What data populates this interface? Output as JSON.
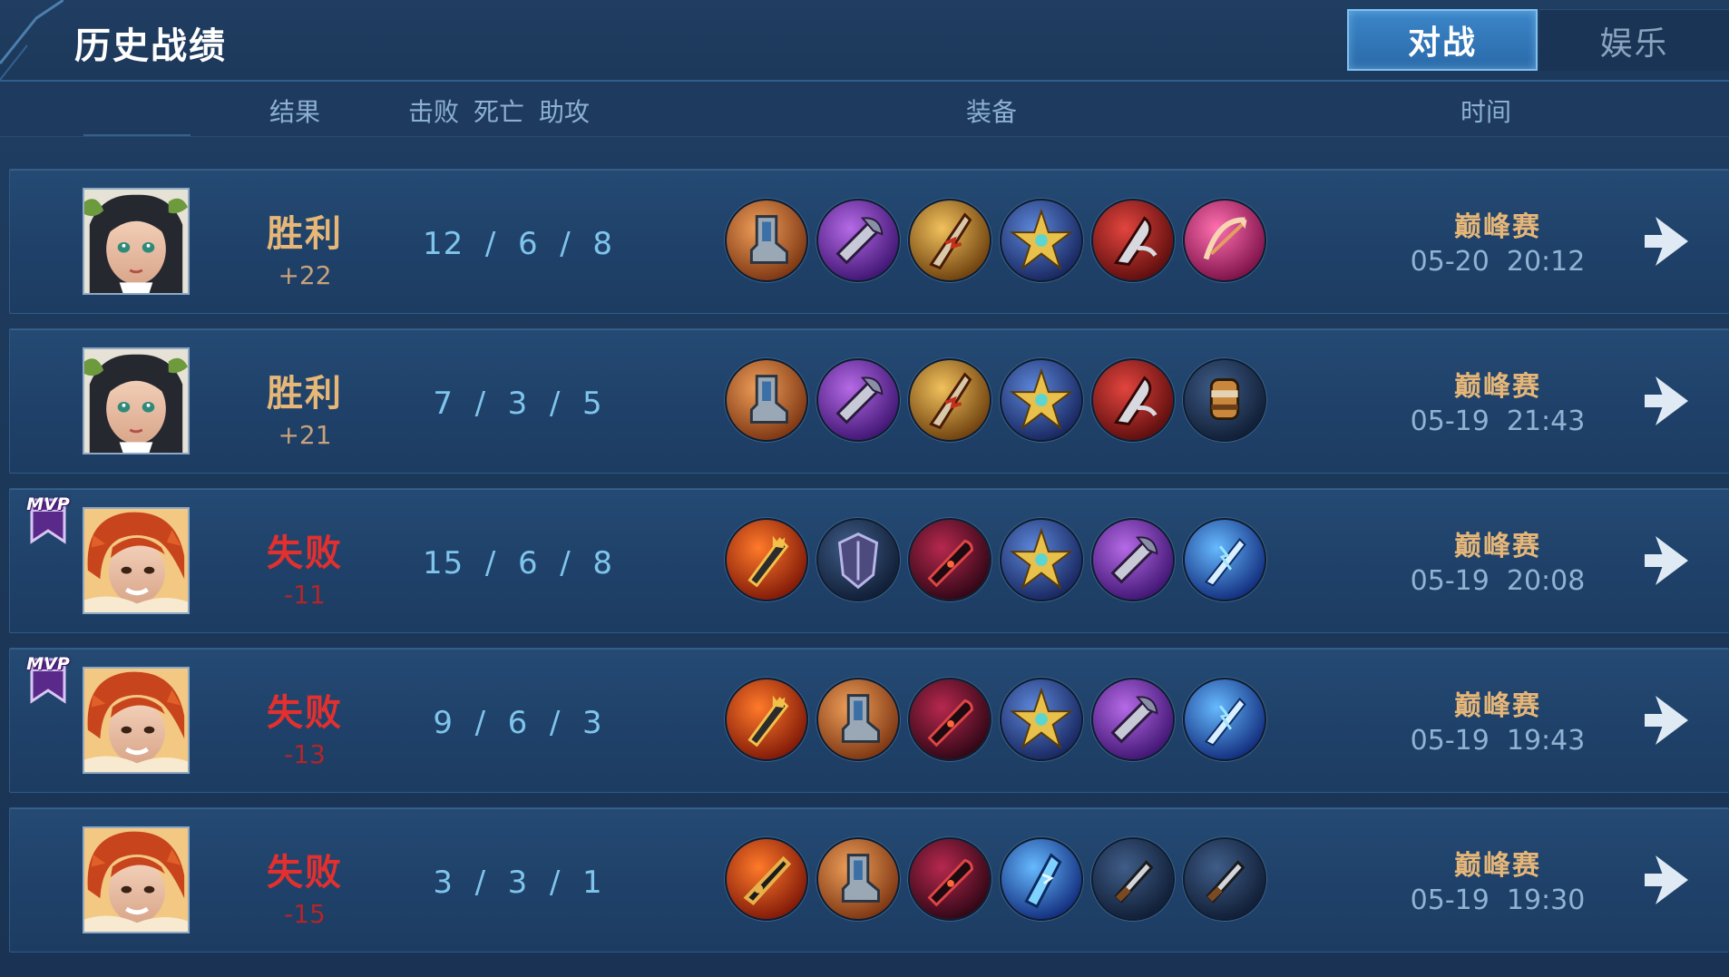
{
  "header": {
    "title": "历史战绩",
    "tabs": [
      {
        "label": "对战",
        "active": true
      },
      {
        "label": "娱乐",
        "active": false
      }
    ]
  },
  "columns": {
    "result": "结果",
    "kill": "击败",
    "death": "死亡",
    "assist": "助攻",
    "equipment": "装备",
    "time": "时间"
  },
  "colors": {
    "win": "#e7b777",
    "lose": "#e2302f",
    "kda": "#7fc4ec",
    "mode": "#e6b678",
    "active_tab": "#3b86c9"
  },
  "matches": [
    {
      "hero": "hero-girl-portrait",
      "mvp": false,
      "outcome": "win",
      "result": "胜利",
      "delta": "+22",
      "kda": "12  /  6  /  8",
      "items": [
        "boots-icon",
        "purple-axe-icon",
        "flame-blade-icon",
        "gold-star-blade-icon",
        "red-claw-icon",
        "pink-bow-icon"
      ],
      "mode": "巅峰赛",
      "time": "05-20  20:12"
    },
    {
      "hero": "hero-girl-portrait",
      "mvp": false,
      "outcome": "win",
      "result": "胜利",
      "delta": "+21",
      "kda": "7  /  3  /  5",
      "items": [
        "boots-icon",
        "purple-axe-icon",
        "flame-blade-icon",
        "gold-star-blade-icon",
        "red-claw-icon",
        "gauntlet-icon"
      ],
      "mode": "巅峰赛",
      "time": "05-19  21:43"
    },
    {
      "hero": "hero-redhair-portrait",
      "mvp": true,
      "mvp_label": "MVP",
      "outcome": "lose",
      "result": "失败",
      "delta": "-11",
      "kda": "15  /  6  /  8",
      "items": [
        "gold-crown-sword-icon",
        "dark-armor-icon",
        "crimson-blade-icon",
        "gold-star-blade-icon",
        "purple-axe-icon",
        "blue-lightning-icon"
      ],
      "mode": "巅峰赛",
      "time": "05-19  20:08"
    },
    {
      "hero": "hero-redhair-portrait",
      "mvp": true,
      "mvp_label": "MVP",
      "outcome": "lose",
      "result": "失败",
      "delta": "-13",
      "kda": "9  /  6  /  3",
      "items": [
        "gold-crown-sword-icon",
        "boots-icon",
        "crimson-blade-icon",
        "gold-star-blade-icon",
        "purple-axe-icon",
        "blue-lightning-icon"
      ],
      "mode": "巅峰赛",
      "time": "05-19  19:43"
    },
    {
      "hero": "hero-redhair-portrait",
      "mvp": false,
      "outcome": "lose",
      "result": "失败",
      "delta": "-15",
      "kda": "3  /  3  /  1",
      "items": [
        "gold-sword-icon",
        "boots-icon",
        "crimson-blade-icon",
        "ice-blade-icon",
        "iron-dagger-icon",
        "iron-dagger-icon"
      ],
      "mode": "巅峰赛",
      "time": "05-19  19:30"
    }
  ]
}
